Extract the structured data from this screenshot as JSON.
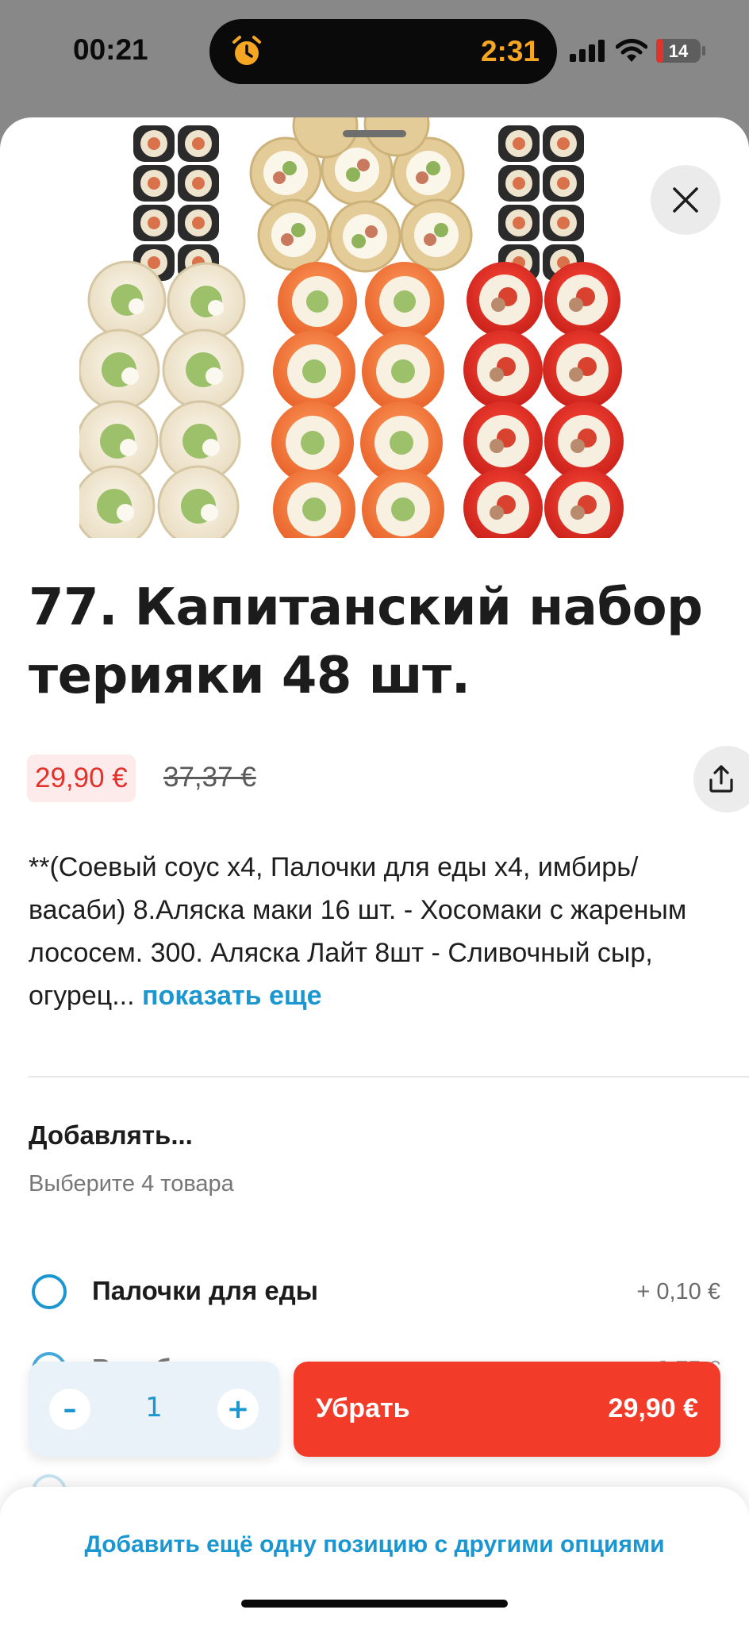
{
  "status_bar": {
    "time": "00:21",
    "timer": "2:31",
    "battery": "14",
    "alarm_icon": "alarm-clock-icon",
    "signal_icon": "cellular-signal-icon",
    "wifi_icon": "wifi-icon",
    "battery_icon": "battery-icon"
  },
  "product": {
    "image_icon": "sushi-set-photo",
    "title": "77. Капитанский набор терияки 48 шт.",
    "price_new": "29,90 €",
    "price_old": "37,37 €",
    "description": "**(Соевый соус х4, Палочки для еды х4, имбирь/васаби) 8.Аляска маки 16 шт. - Хосомаки с жареным лососем. 300. Аляска Лайт 8шт - Сливочный сыр, огурец...",
    "show_more": "показать еще"
  },
  "addons": {
    "title": "Добавлять...",
    "subtitle": "Выберите 4 товара",
    "options": [
      {
        "label": "Палочки для еды",
        "price": "+ 0,10 €"
      },
      {
        "label": "Васаби",
        "price": "+ 0,75 €"
      }
    ]
  },
  "cart": {
    "quantity": "1",
    "minus": "–",
    "plus": "+",
    "action_label": "Убрать",
    "action_price": "29,90 €"
  },
  "footer": {
    "link": "Добавить ещё одну позицию с другими опциями"
  },
  "colors": {
    "accent_blue": "#1a96d1",
    "action_red": "#f23c29",
    "price_red": "#e2322c"
  }
}
